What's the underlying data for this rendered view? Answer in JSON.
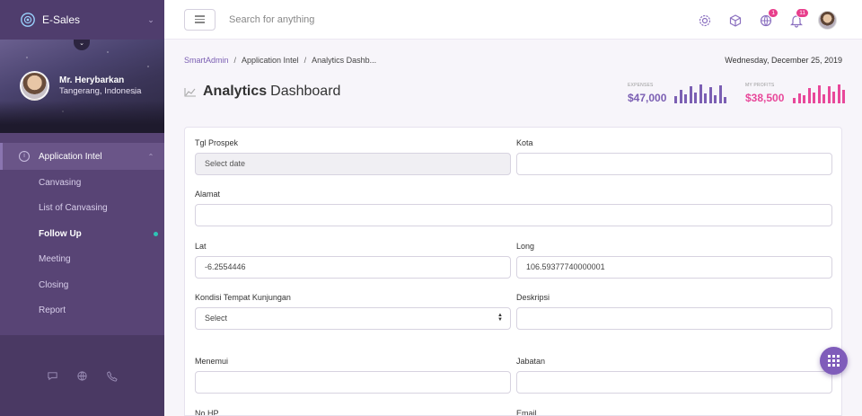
{
  "app": {
    "name": "E-Sales"
  },
  "profile": {
    "name": "Mr. Herybarkan",
    "location": "Tangerang, Indonesia"
  },
  "nav": {
    "group": "Application Intel",
    "items": [
      {
        "label": "Canvasing"
      },
      {
        "label": "List of Canvasing"
      },
      {
        "label": "Follow Up",
        "active": true
      },
      {
        "label": "Meeting"
      },
      {
        "label": "Closing"
      },
      {
        "label": "Report"
      }
    ],
    "footer_icons": [
      "chat-icon",
      "globe-icon",
      "phone-icon"
    ]
  },
  "header": {
    "search_placeholder": "Search for anything",
    "icons": [
      "settings-icon",
      "box-icon",
      "globe-icon",
      "bell-icon"
    ],
    "globe_badge": "1",
    "bell_badge": "11"
  },
  "breadcrumb": {
    "items": [
      "SmartAdmin",
      "Application Intel",
      "Analytics Dashb..."
    ]
  },
  "date": "Wednesday, December 25, 2019",
  "page": {
    "title_strong": "Analytics",
    "title_rest": "Dashboard"
  },
  "stats": {
    "expenses": {
      "label": "EXPENSES",
      "value": "$47,000",
      "color": "#7b5fb3",
      "bars": [
        0.35,
        0.7,
        0.45,
        0.85,
        0.55,
        0.95,
        0.5,
        0.8,
        0.4,
        0.9,
        0.3
      ]
    },
    "profits": {
      "label": "MY PROFITS",
      "value": "$38,500",
      "color": "#e8489a",
      "bars": [
        0.25,
        0.5,
        0.4,
        0.75,
        0.55,
        0.9,
        0.45,
        0.85,
        0.6,
        0.95,
        0.7
      ]
    }
  },
  "form": {
    "tgl_prospek": {
      "label": "Tgl Prospek",
      "value": "Select date"
    },
    "kota": {
      "label": "Kota",
      "value": ""
    },
    "alamat": {
      "label": "Alamat",
      "value": ""
    },
    "lat": {
      "label": "Lat",
      "value": "-6.2554446"
    },
    "long": {
      "label": "Long",
      "value": "106.59377740000001"
    },
    "kondisi": {
      "label": "Kondisi Tempat Kunjungan",
      "value": "Select"
    },
    "deskripsi": {
      "label": "Deskripsi",
      "value": ""
    },
    "menemui": {
      "label": "Menemui",
      "value": ""
    },
    "jabatan": {
      "label": "Jabatan",
      "value": ""
    },
    "no_hp": {
      "label": "No HP"
    },
    "email": {
      "label": "Email"
    }
  },
  "colors": {
    "sidebar": "#584475",
    "accent": "#7b5fb3",
    "pink": "#e8489a",
    "teal": "#2ec3b5"
  }
}
